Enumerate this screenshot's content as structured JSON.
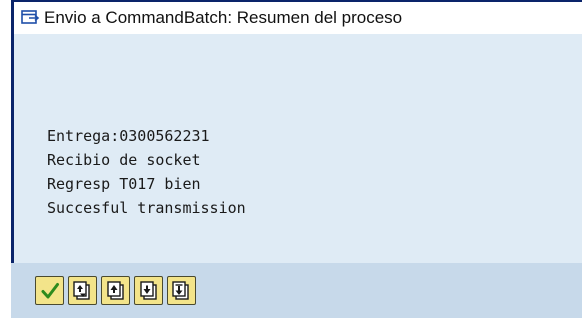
{
  "window": {
    "title": "Envio a CommandBatch: Resumen del proceso",
    "icon": "window-dialog-icon"
  },
  "messages": [
    "Entrega:0300562231",
    "Recibio de socket",
    "Regresp T017 bien",
    "Succesful transmission"
  ],
  "toolbar": {
    "buttons": [
      {
        "icon": "checkmark-icon",
        "name": "continue-button"
      },
      {
        "icon": "page-all-icon",
        "name": "first-page-button"
      },
      {
        "icon": "page-up-icon",
        "name": "previous-page-button"
      },
      {
        "icon": "page-down-icon",
        "name": "next-page-button"
      },
      {
        "icon": "page-last-icon",
        "name": "last-page-button"
      }
    ]
  },
  "colors": {
    "title_border": "#0a246a",
    "content_bg": "#dfebf5",
    "toolbar_bg": "#c7d9ea",
    "button_bg": "#f3e48a",
    "check_green": "#2e8b1e"
  }
}
